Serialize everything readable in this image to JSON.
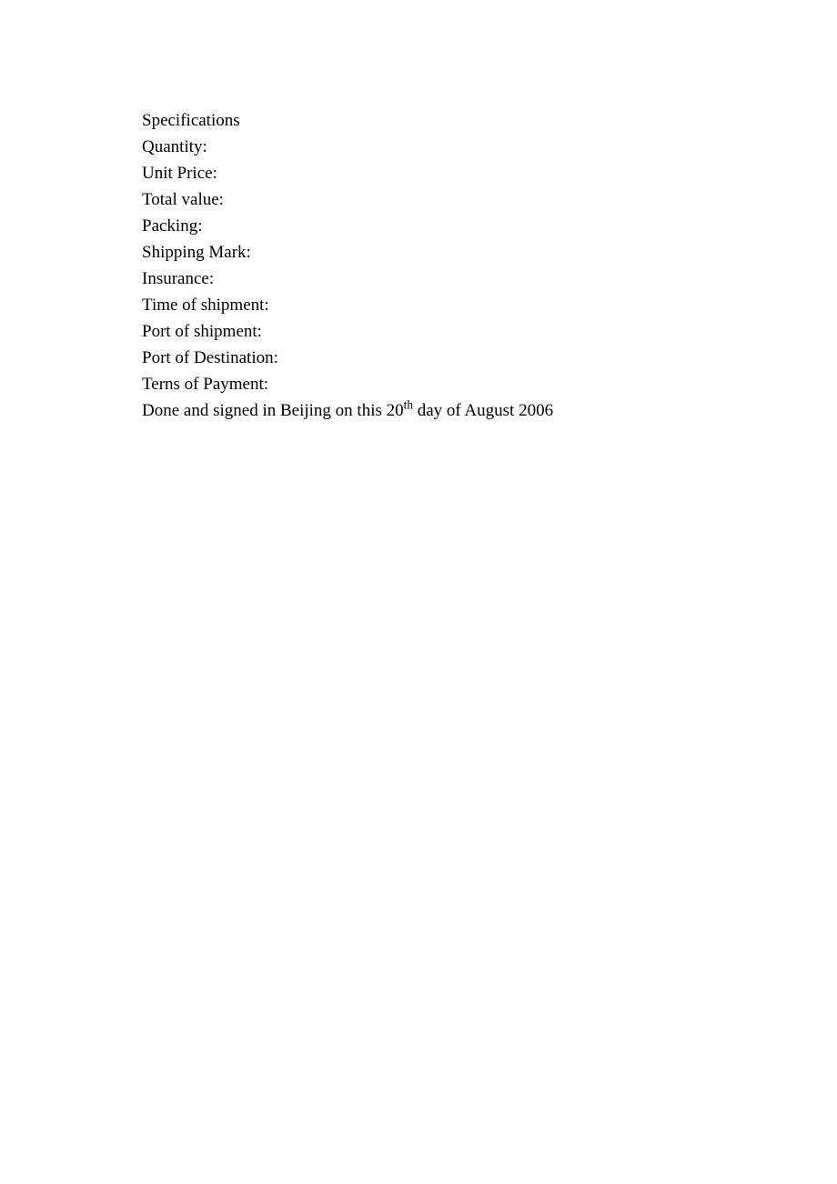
{
  "lines": {
    "specifications": "Specifications",
    "quantity": "Quantity:",
    "unit_price": "Unit Price:",
    "total_value": "Total value:",
    "packing": "Packing:",
    "shipping_mark": "Shipping Mark:",
    "insurance": "Insurance:",
    "time_of_shipment": "Time of shipment:",
    "port_of_shipment": "Port of shipment:",
    "port_of_destination": "Port of Destination:",
    "terms_of_payment": "Terns of Payment:"
  },
  "signature": {
    "prefix": "Done and signed in Beijing on this 20",
    "ordinal": "th",
    "suffix": " day of August 2006"
  }
}
